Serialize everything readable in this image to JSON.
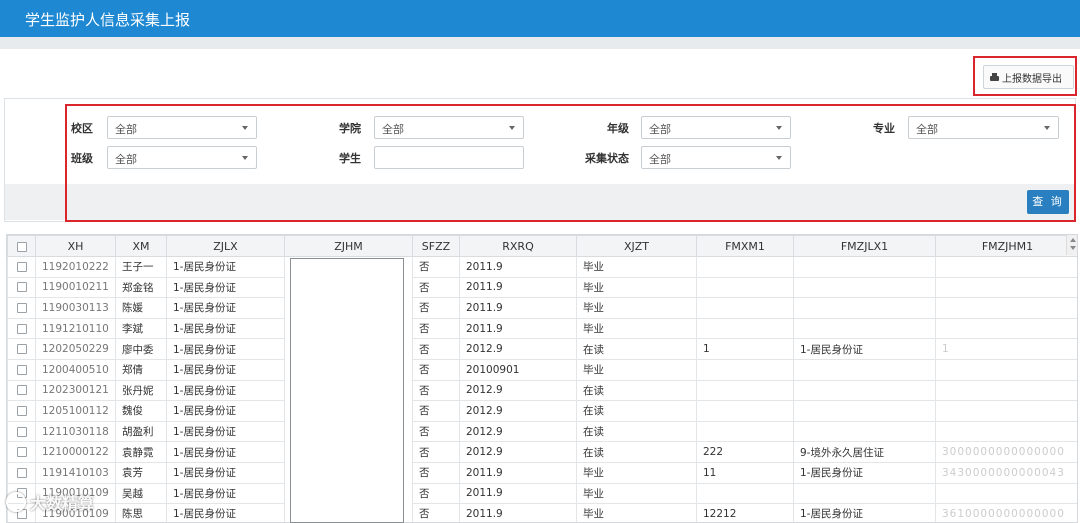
{
  "header": {
    "title": "学生监护人信息采集上报"
  },
  "toolbar": {
    "export_label": "上报数据导出",
    "export_icon": "printer-icon"
  },
  "filters": {
    "campus": {
      "label": "校区",
      "value": "全部"
    },
    "college": {
      "label": "学院",
      "value": "全部"
    },
    "grade": {
      "label": "年级",
      "value": "全部"
    },
    "major": {
      "label": "专业",
      "value": "全部"
    },
    "class": {
      "label": "班级",
      "value": "全部"
    },
    "student": {
      "label": "学生",
      "value": ""
    },
    "status": {
      "label": "采集状态",
      "value": "全部"
    },
    "query_label": "查 询"
  },
  "table": {
    "columns": [
      "XH",
      "XM",
      "ZJLX",
      "ZJHM",
      "SFZZ",
      "RXRQ",
      "XJZT",
      "FMXM1",
      "FMZJLX1",
      "FMZJHM1"
    ],
    "rows": [
      {
        "xh": "1192010222",
        "xm": "王子一",
        "zjlx": "1-居民身份证",
        "sfzz": "否",
        "rxrq": "2011.9",
        "xjzt": "毕业",
        "fmxm1": "",
        "fmzjlx1": "",
        "fmzjhm1": ""
      },
      {
        "xh": "1190010211",
        "xm": "郑金铭",
        "zjlx": "1-居民身份证",
        "sfzz": "否",
        "rxrq": "2011.9",
        "xjzt": "毕业",
        "fmxm1": "",
        "fmzjlx1": "",
        "fmzjhm1": ""
      },
      {
        "xh": "1190030113",
        "xm": "陈媛",
        "zjlx": "1-居民身份证",
        "sfzz": "否",
        "rxrq": "2011.9",
        "xjzt": "毕业",
        "fmxm1": "",
        "fmzjlx1": "",
        "fmzjhm1": ""
      },
      {
        "xh": "1191210110",
        "xm": "李斌",
        "zjlx": "1-居民身份证",
        "sfzz": "否",
        "rxrq": "2011.9",
        "xjzt": "毕业",
        "fmxm1": "",
        "fmzjlx1": "",
        "fmzjhm1": ""
      },
      {
        "xh": "1202050229",
        "xm": "廖中委",
        "zjlx": "1-居民身份证",
        "sfzz": "否",
        "rxrq": "2012.9",
        "xjzt": "在读",
        "fmxm1": "1",
        "fmzjlx1": "1-居民身份证",
        "fmzjhm1": "1"
      },
      {
        "xh": "1200400510",
        "xm": "郑倩",
        "zjlx": "1-居民身份证",
        "sfzz": "否",
        "rxrq": "20100901",
        "xjzt": "毕业",
        "fmxm1": "",
        "fmzjlx1": "",
        "fmzjhm1": ""
      },
      {
        "xh": "1202300121",
        "xm": "张丹妮",
        "zjlx": "1-居民身份证",
        "sfzz": "否",
        "rxrq": "2012.9",
        "xjzt": "在读",
        "fmxm1": "",
        "fmzjlx1": "",
        "fmzjhm1": ""
      },
      {
        "xh": "1205100112",
        "xm": "魏俊",
        "zjlx": "1-居民身份证",
        "sfzz": "否",
        "rxrq": "2012.9",
        "xjzt": "在读",
        "fmxm1": "",
        "fmzjlx1": "",
        "fmzjhm1": ""
      },
      {
        "xh": "1211030118",
        "xm": "胡盈利",
        "zjlx": "1-居民身份证",
        "sfzz": "否",
        "rxrq": "2012.9",
        "xjzt": "在读",
        "fmxm1": "",
        "fmzjlx1": "",
        "fmzjhm1": ""
      },
      {
        "xh": "1210000122",
        "xm": "袁静霓",
        "zjlx": "1-居民身份证",
        "sfzz": "否",
        "rxrq": "2012.9",
        "xjzt": "在读",
        "fmxm1": "222",
        "fmzjlx1": "9-境外永久居住证",
        "fmzjhm1": "3000000000000000"
      },
      {
        "xh": "1191410103",
        "xm": "袁芳",
        "zjlx": "1-居民身份证",
        "sfzz": "否",
        "rxrq": "2011.9",
        "xjzt": "毕业",
        "fmxm1": "11",
        "fmzjlx1": "1-居民身份证",
        "fmzjhm1": "3430000000000043"
      },
      {
        "xh": "1190010109",
        "xm": "吴越",
        "zjlx": "1-居民身份证",
        "sfzz": "否",
        "rxrq": "2011.9",
        "xjzt": "毕业",
        "fmxm1": "",
        "fmzjlx1": "",
        "fmzjhm1": ""
      },
      {
        "xh": "1190010109",
        "xm": "陈思",
        "zjlx": "1-居民身份证",
        "sfzz": "否",
        "rxrq": "2011.9",
        "xjzt": "毕业",
        "fmxm1": "12212",
        "fmzjlx1": "1-居民身份证",
        "fmzjhm1": "3610000000000000"
      }
    ]
  },
  "watermark": {
    "text": "大数精算"
  }
}
